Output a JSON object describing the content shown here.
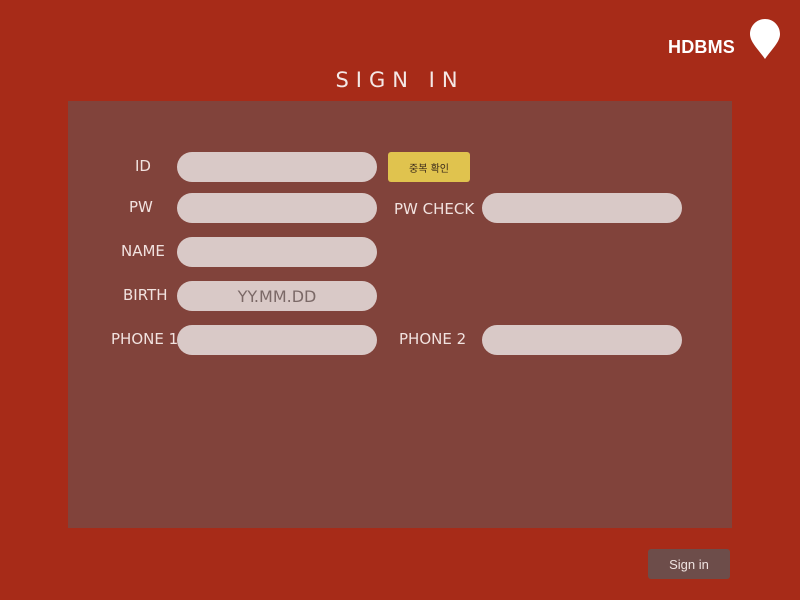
{
  "brand": {
    "name": "HDBMS",
    "icon": "map-pin-icon"
  },
  "page": {
    "title": "SIGN IN"
  },
  "form": {
    "id_label": "ID",
    "id_value": "",
    "duplicate_check_label": "중복 확인",
    "pw_label": "PW",
    "pw_value": "",
    "pw_check_label": "PW CHECK",
    "pw_check_value": "",
    "name_label": "NAME",
    "name_value": "",
    "birth_label": "BIRTH",
    "birth_placeholder": "YY.MM.DD",
    "phone1_label": "PHONE 1",
    "phone1_value": "",
    "phone2_label": "PHONE 2",
    "phone2_value": ""
  },
  "actions": {
    "signin_label": "Sign in"
  },
  "colors": {
    "background": "#a72b18",
    "panel": "#81433b",
    "input": "#d9c9c7",
    "duplicate_button": "#e0c34e",
    "signin_button": "#6d4d4a"
  }
}
